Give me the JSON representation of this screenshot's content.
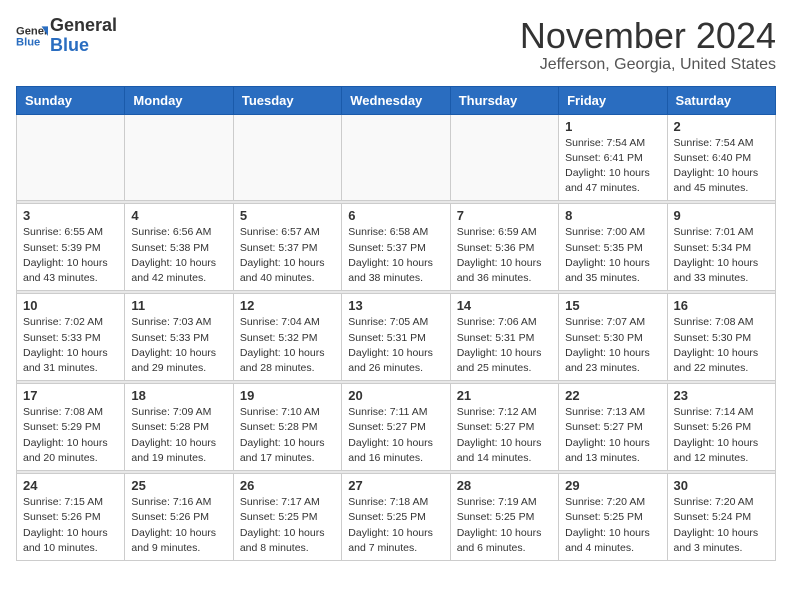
{
  "logo": {
    "general": "General",
    "blue": "Blue"
  },
  "title": "November 2024",
  "location": "Jefferson, Georgia, United States",
  "days_header": [
    "Sunday",
    "Monday",
    "Tuesday",
    "Wednesday",
    "Thursday",
    "Friday",
    "Saturday"
  ],
  "weeks": [
    [
      {
        "day": "",
        "info": ""
      },
      {
        "day": "",
        "info": ""
      },
      {
        "day": "",
        "info": ""
      },
      {
        "day": "",
        "info": ""
      },
      {
        "day": "",
        "info": ""
      },
      {
        "day": "1",
        "info": "Sunrise: 7:54 AM\nSunset: 6:41 PM\nDaylight: 10 hours\nand 47 minutes."
      },
      {
        "day": "2",
        "info": "Sunrise: 7:54 AM\nSunset: 6:40 PM\nDaylight: 10 hours\nand 45 minutes."
      }
    ],
    [
      {
        "day": "3",
        "info": "Sunrise: 6:55 AM\nSunset: 5:39 PM\nDaylight: 10 hours\nand 43 minutes."
      },
      {
        "day": "4",
        "info": "Sunrise: 6:56 AM\nSunset: 5:38 PM\nDaylight: 10 hours\nand 42 minutes."
      },
      {
        "day": "5",
        "info": "Sunrise: 6:57 AM\nSunset: 5:37 PM\nDaylight: 10 hours\nand 40 minutes."
      },
      {
        "day": "6",
        "info": "Sunrise: 6:58 AM\nSunset: 5:37 PM\nDaylight: 10 hours\nand 38 minutes."
      },
      {
        "day": "7",
        "info": "Sunrise: 6:59 AM\nSunset: 5:36 PM\nDaylight: 10 hours\nand 36 minutes."
      },
      {
        "day": "8",
        "info": "Sunrise: 7:00 AM\nSunset: 5:35 PM\nDaylight: 10 hours\nand 35 minutes."
      },
      {
        "day": "9",
        "info": "Sunrise: 7:01 AM\nSunset: 5:34 PM\nDaylight: 10 hours\nand 33 minutes."
      }
    ],
    [
      {
        "day": "10",
        "info": "Sunrise: 7:02 AM\nSunset: 5:33 PM\nDaylight: 10 hours\nand 31 minutes."
      },
      {
        "day": "11",
        "info": "Sunrise: 7:03 AM\nSunset: 5:33 PM\nDaylight: 10 hours\nand 29 minutes."
      },
      {
        "day": "12",
        "info": "Sunrise: 7:04 AM\nSunset: 5:32 PM\nDaylight: 10 hours\nand 28 minutes."
      },
      {
        "day": "13",
        "info": "Sunrise: 7:05 AM\nSunset: 5:31 PM\nDaylight: 10 hours\nand 26 minutes."
      },
      {
        "day": "14",
        "info": "Sunrise: 7:06 AM\nSunset: 5:31 PM\nDaylight: 10 hours\nand 25 minutes."
      },
      {
        "day": "15",
        "info": "Sunrise: 7:07 AM\nSunset: 5:30 PM\nDaylight: 10 hours\nand 23 minutes."
      },
      {
        "day": "16",
        "info": "Sunrise: 7:08 AM\nSunset: 5:30 PM\nDaylight: 10 hours\nand 22 minutes."
      }
    ],
    [
      {
        "day": "17",
        "info": "Sunrise: 7:08 AM\nSunset: 5:29 PM\nDaylight: 10 hours\nand 20 minutes."
      },
      {
        "day": "18",
        "info": "Sunrise: 7:09 AM\nSunset: 5:28 PM\nDaylight: 10 hours\nand 19 minutes."
      },
      {
        "day": "19",
        "info": "Sunrise: 7:10 AM\nSunset: 5:28 PM\nDaylight: 10 hours\nand 17 minutes."
      },
      {
        "day": "20",
        "info": "Sunrise: 7:11 AM\nSunset: 5:27 PM\nDaylight: 10 hours\nand 16 minutes."
      },
      {
        "day": "21",
        "info": "Sunrise: 7:12 AM\nSunset: 5:27 PM\nDaylight: 10 hours\nand 14 minutes."
      },
      {
        "day": "22",
        "info": "Sunrise: 7:13 AM\nSunset: 5:27 PM\nDaylight: 10 hours\nand 13 minutes."
      },
      {
        "day": "23",
        "info": "Sunrise: 7:14 AM\nSunset: 5:26 PM\nDaylight: 10 hours\nand 12 minutes."
      }
    ],
    [
      {
        "day": "24",
        "info": "Sunrise: 7:15 AM\nSunset: 5:26 PM\nDaylight: 10 hours\nand 10 minutes."
      },
      {
        "day": "25",
        "info": "Sunrise: 7:16 AM\nSunset: 5:26 PM\nDaylight: 10 hours\nand 9 minutes."
      },
      {
        "day": "26",
        "info": "Sunrise: 7:17 AM\nSunset: 5:25 PM\nDaylight: 10 hours\nand 8 minutes."
      },
      {
        "day": "27",
        "info": "Sunrise: 7:18 AM\nSunset: 5:25 PM\nDaylight: 10 hours\nand 7 minutes."
      },
      {
        "day": "28",
        "info": "Sunrise: 7:19 AM\nSunset: 5:25 PM\nDaylight: 10 hours\nand 6 minutes."
      },
      {
        "day": "29",
        "info": "Sunrise: 7:20 AM\nSunset: 5:25 PM\nDaylight: 10 hours\nand 4 minutes."
      },
      {
        "day": "30",
        "info": "Sunrise: 7:20 AM\nSunset: 5:24 PM\nDaylight: 10 hours\nand 3 minutes."
      }
    ]
  ]
}
